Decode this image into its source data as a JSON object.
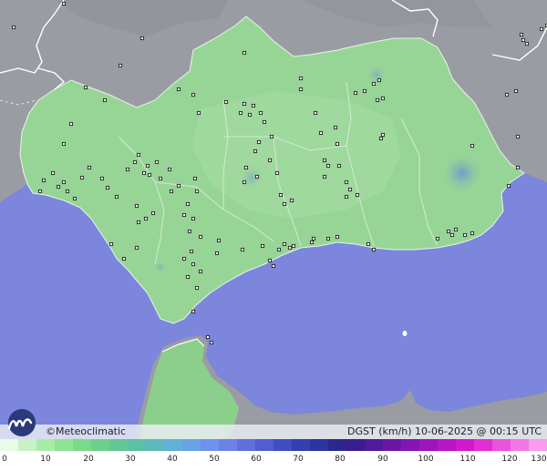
{
  "brand": {
    "copyright": "©",
    "name": "Meteoclimatic"
  },
  "title": {
    "variable": "DGST",
    "unit": "(km/h)",
    "date": "10-06-2025",
    "at": "@",
    "time": "00:15",
    "tz": "UTC"
  },
  "colors": {
    "sea": "#7b86dc",
    "land_out": "#9a9ca3",
    "land_region": "#97d597",
    "border": "#ffffff"
  },
  "scale": {
    "ticks": [
      "0",
      "10",
      "20",
      "30",
      "40",
      "50",
      "60",
      "70",
      "80",
      "90",
      "100",
      "110",
      "120",
      "130"
    ],
    "colors": [
      "#e8fbe6",
      "#c8f2c4",
      "#a8eba6",
      "#90e391",
      "#7dd98a",
      "#6cd08a",
      "#62c794",
      "#5cc0a4",
      "#5eb9bc",
      "#63b0d6",
      "#6aa2e6",
      "#6f92ec",
      "#6c82e8",
      "#5f70de",
      "#4f5fd2",
      "#3f4fc3",
      "#3241b1",
      "#2b349f",
      "#2a288d",
      "#3a1d8f",
      "#521a9c",
      "#6a17a8",
      "#8415b4",
      "#9e14bf",
      "#b715c8",
      "#d01acc",
      "#e12fd3",
      "#ea53dc",
      "#f277e4",
      "#f89cec"
    ]
  },
  "icons": {
    "logo": "meteoclimatic-logo-icon",
    "station": "station-marker-icon"
  }
}
